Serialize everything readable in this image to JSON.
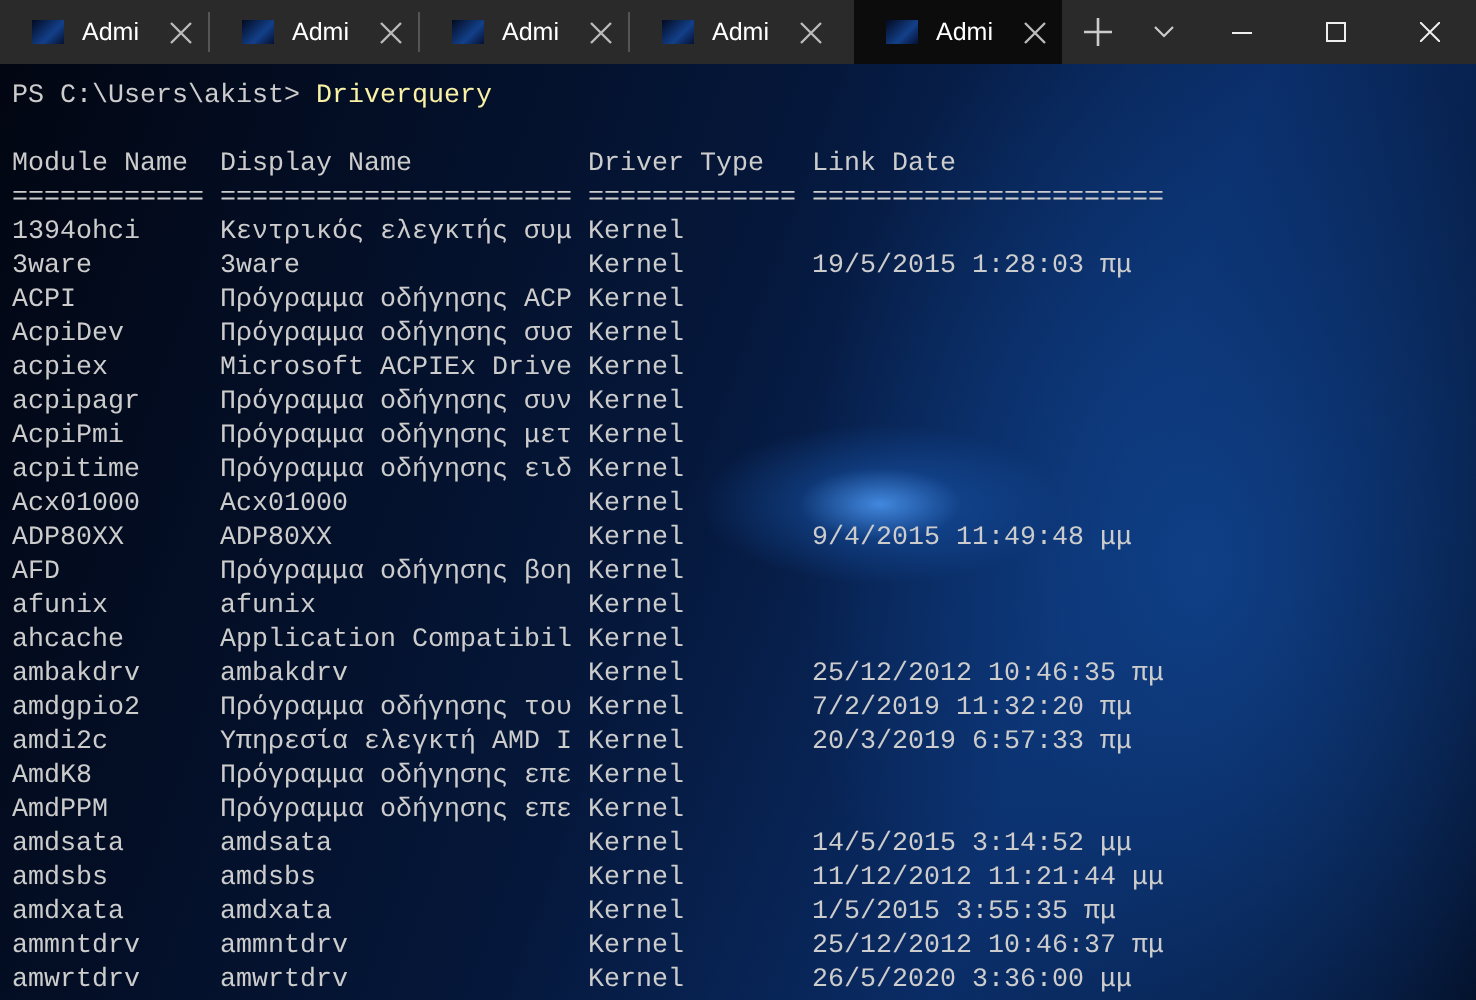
{
  "tabs": [
    {
      "title": "Admi",
      "selected": false
    },
    {
      "title": "Admi",
      "selected": false
    },
    {
      "title": "Admi",
      "selected": false
    },
    {
      "title": "Admi",
      "selected": false
    },
    {
      "title": "Admi",
      "selected": true
    }
  ],
  "terminal": {
    "prompt": "PS C:\\Users\\akist>",
    "command": "Driverquery",
    "columns": [
      "Module Name",
      "Display Name",
      "Driver Type",
      "Link Date"
    ],
    "separators": [
      "============",
      "======================",
      "=============",
      "======================"
    ],
    "rows": [
      {
        "module": "1394ohci",
        "display": "Κεντρικός ελεγκτής συμ",
        "type": "Kernel"
      },
      {
        "module": "3ware",
        "display": "3ware",
        "type": "Kernel",
        "date": "19/5/2015 1:28:03 πμ"
      },
      {
        "module": "ACPI",
        "display": "Πρόγραμμα οδήγησης ACP",
        "type": "Kernel"
      },
      {
        "module": "AcpiDev",
        "display": "Πρόγραμμα οδήγησης συσ",
        "type": "Kernel"
      },
      {
        "module": "acpiex",
        "display": "Microsoft ACPIEx Drive",
        "type": "Kernel"
      },
      {
        "module": "acpipagr",
        "display": "Πρόγραμμα οδήγησης συν",
        "type": "Kernel"
      },
      {
        "module": "AcpiPmi",
        "display": "Πρόγραμμα οδήγησης μετ",
        "type": "Kernel"
      },
      {
        "module": "acpitime",
        "display": "Πρόγραμμα οδήγησης ειδ",
        "type": "Kernel"
      },
      {
        "module": "Acx01000",
        "display": "Acx01000",
        "type": "Kernel"
      },
      {
        "module": "ADP80XX",
        "display": "ADP80XX",
        "type": "Kernel",
        "date": "9/4/2015 11:49:48 μμ"
      },
      {
        "module": "AFD",
        "display": "Πρόγραμμα οδήγησης βοη",
        "type": "Kernel"
      },
      {
        "module": "afunix",
        "display": "afunix",
        "type": "Kernel"
      },
      {
        "module": "ahcache",
        "display": "Application Compatibil",
        "type": "Kernel"
      },
      {
        "module": "ambakdrv",
        "display": "ambakdrv",
        "type": "Kernel",
        "date": "25/12/2012 10:46:35 πμ"
      },
      {
        "module": "amdgpio2",
        "display": "Πρόγραμμα οδήγησης του",
        "type": "Kernel",
        "date": "7/2/2019 11:32:20 πμ"
      },
      {
        "module": "amdi2c",
        "display": "Υπηρεσία ελεγκτή AMD I",
        "type": "Kernel",
        "date": "20/3/2019 6:57:33 πμ"
      },
      {
        "module": "AmdK8",
        "display": "Πρόγραμμα οδήγησης επε",
        "type": "Kernel"
      },
      {
        "module": "AmdPPM",
        "display": "Πρόγραμμα οδήγησης επε",
        "type": "Kernel"
      },
      {
        "module": "amdsata",
        "display": "amdsata",
        "type": "Kernel",
        "date": "14/5/2015 3:14:52 μμ"
      },
      {
        "module": "amdsbs",
        "display": "amdsbs",
        "type": "Kernel",
        "date": "11/12/2012 11:21:44 μμ"
      },
      {
        "module": "amdxata",
        "display": "amdxata",
        "type": "Kernel",
        "date": "1/5/2015 3:55:35 πμ"
      },
      {
        "module": "ammntdrv",
        "display": "ammntdrv",
        "type": "Kernel",
        "date": "25/12/2012 10:46:37 πμ"
      },
      {
        "module": "amwrtdrv",
        "display": "amwrtdrv",
        "type": "Kernel",
        "date": "26/5/2020 3:36:00 μμ"
      }
    ]
  }
}
